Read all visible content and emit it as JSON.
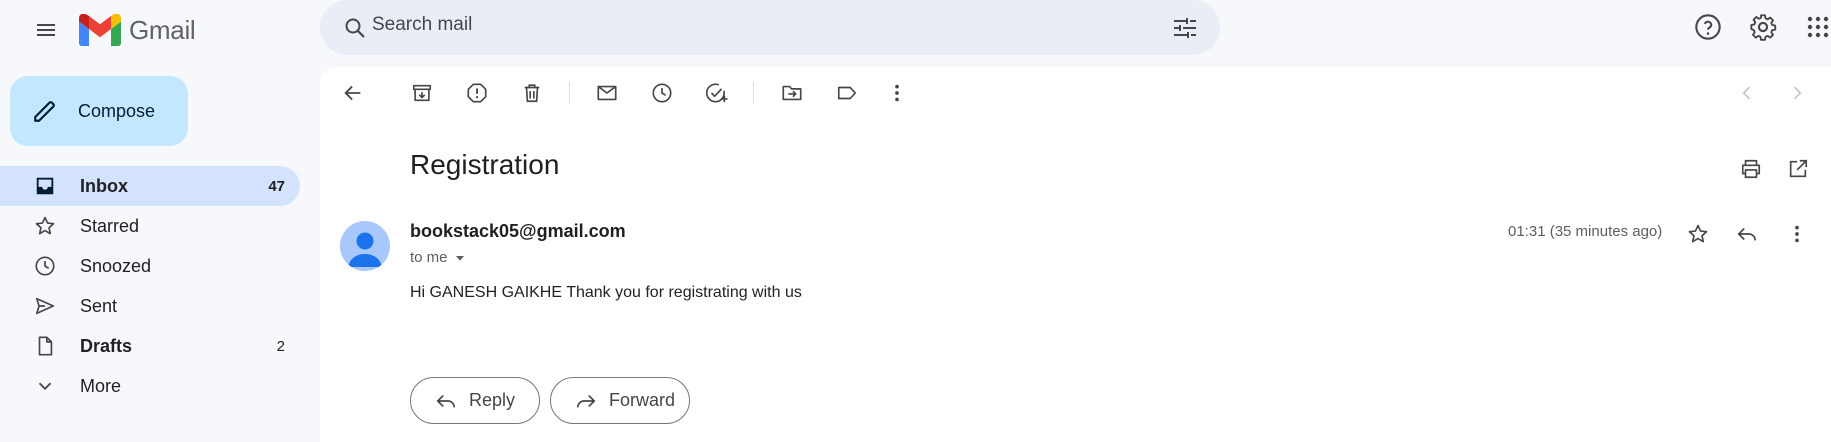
{
  "header": {
    "logo_text": "Gmail",
    "search_placeholder": "Search mail"
  },
  "sidebar": {
    "compose_label": "Compose",
    "items": [
      {
        "label": "Inbox",
        "count": "47",
        "icon": "inbox-icon",
        "active": true
      },
      {
        "label": "Starred",
        "count": "",
        "icon": "star-icon"
      },
      {
        "label": "Snoozed",
        "count": "",
        "icon": "clock-icon"
      },
      {
        "label": "Sent",
        "count": "",
        "icon": "send-icon"
      },
      {
        "label": "Drafts",
        "count": "2",
        "icon": "draft-icon"
      },
      {
        "label": "More",
        "count": "",
        "icon": "chevron-down-icon"
      }
    ]
  },
  "toolbar": {
    "icons": [
      "back-icon",
      "archive-icon",
      "report-spam-icon",
      "delete-icon",
      "mark-unread-icon",
      "snooze-icon",
      "add-task-icon",
      "move-to-icon",
      "label-icon",
      "more-icon"
    ]
  },
  "message": {
    "subject": "Registration",
    "sender": "bookstack05@gmail.com",
    "recipient": "to me",
    "timestamp": "01:31 (35 minutes ago)",
    "body": "Hi GANESH GAIKHE Thank you for registrating with us"
  },
  "actions": {
    "reply_label": "Reply",
    "forward_label": "Forward"
  },
  "colors": {
    "background": "#f6f8fc",
    "compose": "#c2e7ff",
    "active_nav": "#d3e3fd",
    "search": "#e9eef6",
    "avatar": "#a8c7fa"
  }
}
